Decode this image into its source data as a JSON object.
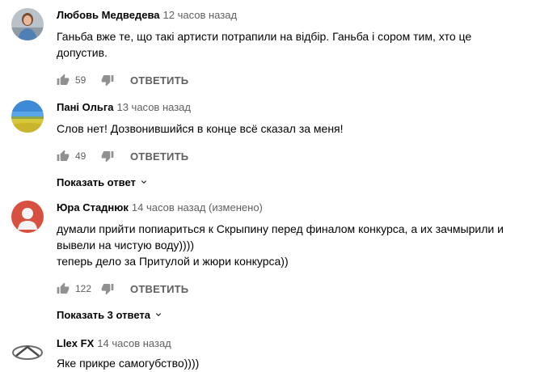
{
  "comments": [
    {
      "author": "Любовь Медведева",
      "time": "12 часов назад",
      "text_lines": [
        "Ганьба вже те, що такі артисти потрапили на відбір. Ганьба і сором тим, хто це",
        "допустив."
      ],
      "likes": "59",
      "reply_label": "ОТВЕТИТЬ",
      "show_replies": ""
    },
    {
      "author": "Пані Ольга",
      "time": "13 часов назад",
      "text_lines": [
        "Слов нет! Дозвонившийся в конце всё сказал за меня!"
      ],
      "likes": "49",
      "reply_label": "ОТВЕТИТЬ",
      "show_replies": "Показать ответ"
    },
    {
      "author": "Юра Стаднюк",
      "time": "14 часов назад (изменено)",
      "text_lines": [
        "думали прийти попиариться к Скрыпину перед финалом конкурса, а их зачмырили и",
        "вывели на чистую воду))))",
        "теперь дело за Притулой и жюри конкурса))"
      ],
      "likes": "122",
      "reply_label": "ОТВЕТИТЬ",
      "show_replies": "Показать 3 ответа"
    },
    {
      "author": "Llex FX",
      "time": "14 часов назад",
      "text_lines": [
        "Яке прикре самогубство))))"
      ],
      "likes": "",
      "reply_label": "",
      "show_replies": ""
    }
  ],
  "icons": {
    "like": "thumb-up-icon",
    "dislike": "thumb-down-icon",
    "expand": "chevron-down-icon"
  },
  "colors": {
    "text": "#030303",
    "secondary": "#606060",
    "icon": "#909090"
  }
}
